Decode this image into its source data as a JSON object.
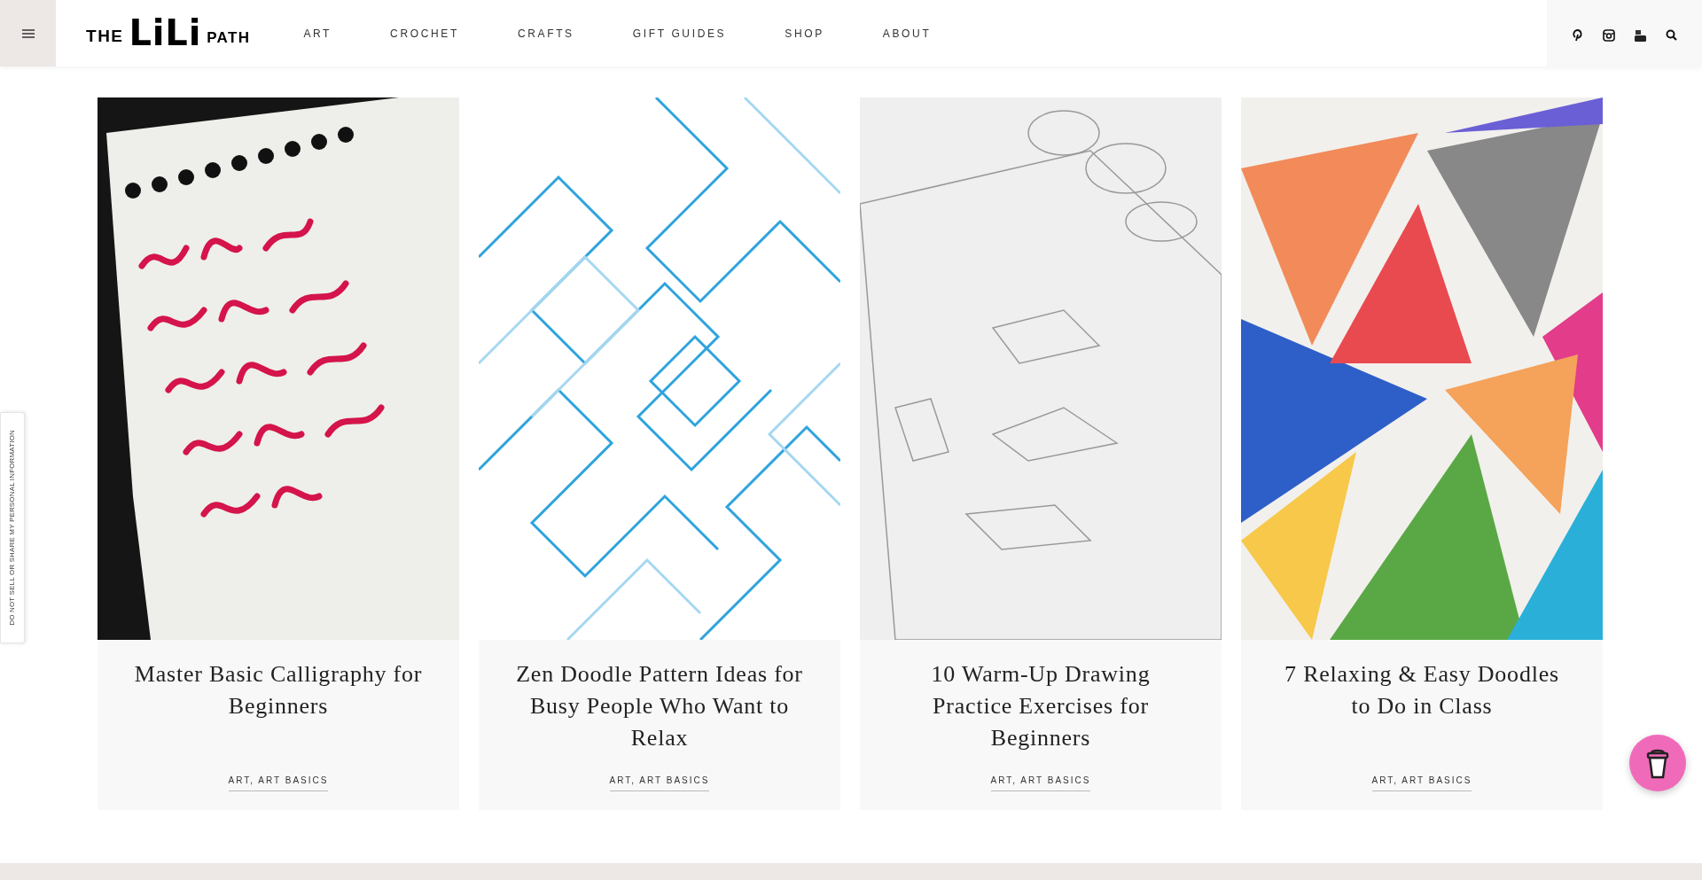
{
  "header": {
    "logo": [
      "THE",
      "LiLi",
      "PATH"
    ],
    "nav": [
      "ART",
      "CROCHET",
      "CRAFTS",
      "GIFT GUIDES",
      "SHOP",
      "ABOUT"
    ]
  },
  "side_tab": "DO NOT SELL OR SHARE MY PERSONAL INFORMATION",
  "posts": [
    {
      "kind": "calligraphy",
      "title": "Master Basic Calligraphy for Beginners",
      "categories": "ART, ART BASICS"
    },
    {
      "kind": "maze",
      "title": "Zen Doodle Pattern Ideas for Busy People Who Want to Relax",
      "categories": "ART, ART BASICS"
    },
    {
      "kind": "sketch",
      "title": "10 Warm-Up Drawing Practice Exercises for Beginners",
      "categories": "ART, ART BASICS"
    },
    {
      "kind": "colorful",
      "title": "7 Relaxing & Easy Doodles to Do in Class",
      "categories": "ART, ART BASICS"
    }
  ]
}
